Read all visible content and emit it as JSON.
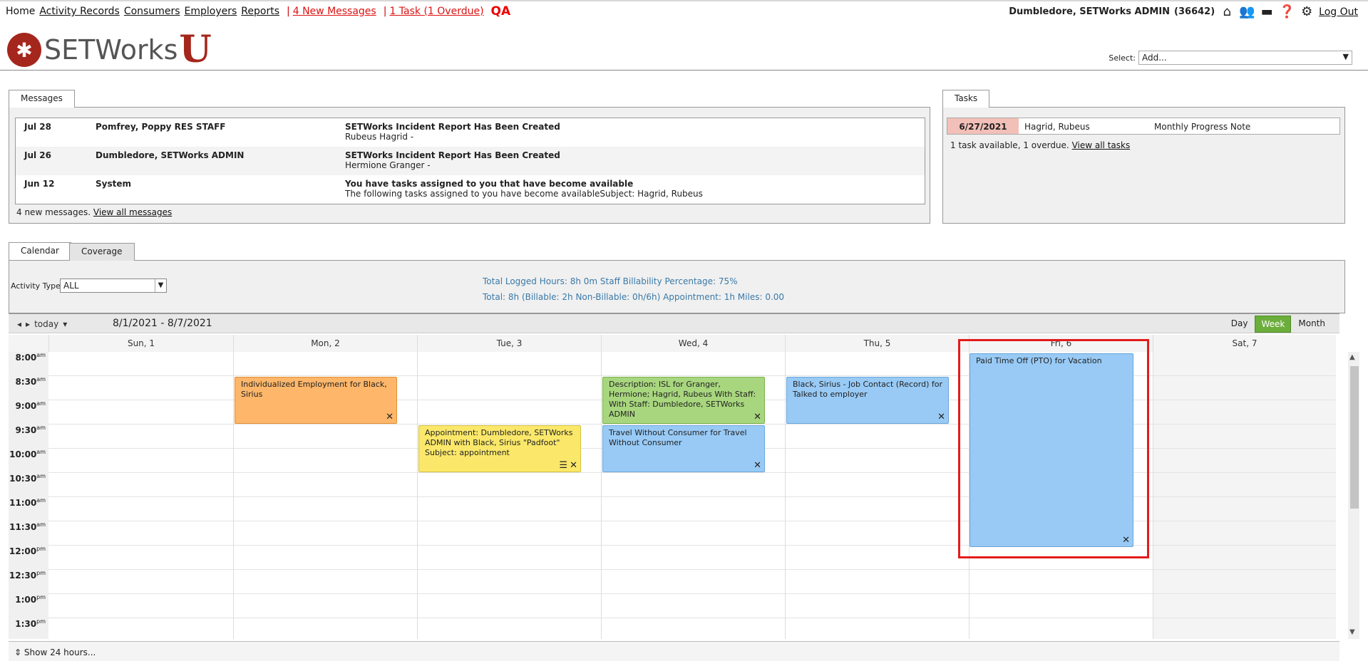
{
  "nav": {
    "home": "Home",
    "activity_records": "Activity Records",
    "consumers": "Consumers",
    "employers": "Employers",
    "reports": "Reports",
    "sep1": "|",
    "messages": "4 New Messages",
    "sep2": "|",
    "tasks": "1 Task (1 Overdue)",
    "env": "QA"
  },
  "user": {
    "name": "Dumbledore, SETWorks ADMIN",
    "id": "(36642)",
    "logout": "Log Out",
    "icons": [
      "home-icon",
      "users-icon",
      "briefcase-icon",
      "help-icon",
      "gear-icon"
    ]
  },
  "logo": {
    "text": "SETWorks",
    "u": "U"
  },
  "select": {
    "label": "Select:",
    "value": "Add..."
  },
  "messages_panel": {
    "tab": "Messages",
    "rows": [
      {
        "date": "Jul 28",
        "from": "Pomfrey, Poppy RES STAFF",
        "subject": "SETWorks Incident Report Has Been Created",
        "detail": "Rubeus Hagrid -"
      },
      {
        "date": "Jul 26",
        "from": "Dumbledore, SETWorks ADMIN",
        "subject": "SETWorks Incident Report Has Been Created",
        "detail": "Hermione Granger -"
      },
      {
        "date": "Jun 12",
        "from": "System",
        "subject": "You have tasks assigned to you that have become available",
        "detail": "The following tasks assigned to you have become availableSubject: Hagrid, Rubeus"
      }
    ],
    "footer_text": "4 new messages.",
    "footer_link": "View all messages"
  },
  "tasks_panel": {
    "tab": "Tasks",
    "row": {
      "date": "6/27/2021",
      "who": "Hagrid, Rubeus",
      "what": "Monthly Progress Note"
    },
    "footer_text": "1 task available, 1 overdue.",
    "footer_link": "View all tasks"
  },
  "calendar_tabs": {
    "calendar": "Calendar",
    "coverage": "Coverage"
  },
  "filter": {
    "label": "Activity Type:",
    "value": "ALL"
  },
  "totals": {
    "line1": "Total Logged Hours: 8h 0m   Staff Billability Percentage: 75%",
    "line2": "Total: 8h   (Billable: 2h   Non-Billable: 0h/6h)   Appointment: 1h   Miles: 0.00"
  },
  "toolbar": {
    "prev": "◂",
    "next": "▸",
    "today": "today",
    "range": "8/1/2021 - 8/7/2021",
    "views": [
      "Day",
      "Week",
      "Month"
    ],
    "active_view": "Week"
  },
  "days": [
    "Sun, 1",
    "Mon, 2",
    "Tue, 3",
    "Wed, 4",
    "Thu, 5",
    "Fri, 6",
    "Sat, 7"
  ],
  "times": [
    {
      "t": "8:00",
      "p": "am"
    },
    {
      "t": "8:30",
      "p": "am"
    },
    {
      "t": "9:00",
      "p": "am"
    },
    {
      "t": "9:30",
      "p": "am"
    },
    {
      "t": "10:00",
      "p": "am"
    },
    {
      "t": "10:30",
      "p": "am"
    },
    {
      "t": "11:00",
      "p": "am"
    },
    {
      "t": "11:30",
      "p": "am"
    },
    {
      "t": "12:00",
      "p": "pm"
    },
    {
      "t": "12:30",
      "p": "pm"
    },
    {
      "t": "1:00",
      "p": "pm"
    },
    {
      "t": "1:30",
      "p": "pm"
    }
  ],
  "events": {
    "mon": "Individualized Employment for Black, Sirius",
    "tue": "Appointment: Dumbledore, SETWorks ADMIN with Black, Sirius \"Padfoot\" Subject: appointment",
    "wed1": "Description: ISL for Granger, Hermione; Hagrid, Rubeus With Staff: With Staff: Dumbledore, SETWorks ADMIN",
    "wed2": "Travel Without Consumer for Travel Without Consumer",
    "thu": "Black, Sirius - Job Contact (Record) for Talked to employer",
    "fri": "Paid Time Off (PTO) for Vacation"
  },
  "footer": {
    "show24": "Show 24 hours..."
  },
  "colors": {
    "orange": "#fdb66a",
    "yellow": "#fbe86a",
    "green": "#a8d67e",
    "blue": "#98caf5",
    "highlight": "#e41b1b",
    "active_view": "#6cae3c"
  }
}
